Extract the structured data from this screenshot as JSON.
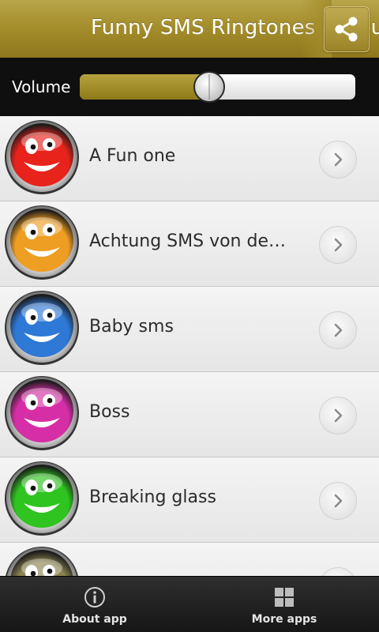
{
  "header": {
    "title": "Funny SMS Ringtones & Sounds",
    "share_icon": "share-icon"
  },
  "volume": {
    "label": "Volume",
    "level": 0.47
  },
  "ringtones": [
    {
      "name": "A Fun one",
      "color": "#e8231c"
    },
    {
      "name": "Achtung SMS von der Polizei",
      "color": "#ee9e22"
    },
    {
      "name": "Baby sms",
      "color": "#2e78d6"
    },
    {
      "name": "Boss",
      "color": "#d62ea6"
    },
    {
      "name": "Breaking glass",
      "color": "#2fc41f"
    },
    {
      "name": "",
      "color": "#8a8350"
    }
  ],
  "bottom_bar": {
    "about_label": "About app",
    "about_icon": "info-icon",
    "more_label": "More apps",
    "more_icon": "grid-icon"
  },
  "colors": {
    "header_gold": "#a58e2c",
    "slider_fill": "#9e8a28"
  }
}
